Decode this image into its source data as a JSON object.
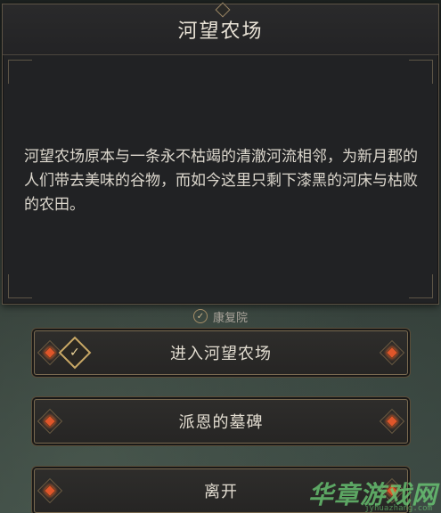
{
  "dialog": {
    "title": "河望农场",
    "description": "河望农场原本与一条永不枯竭的清澈河流相邻，为新月郡的人们带去美味的谷物，而如今这里只剩下漆黑的河床与枯败的农田。"
  },
  "requirement": {
    "icon": "check-circle-icon",
    "text": "康复院"
  },
  "options": [
    {
      "label": "进入河望农场",
      "badge": "check-icon"
    },
    {
      "label": "派恩的墓碑"
    },
    {
      "label": "离开"
    }
  ],
  "watermark": {
    "text": "华章游戏网",
    "sub": "jyhuazhang.com"
  },
  "colors": {
    "accent_gem": "#e0562a",
    "border_gold": "#7a6a50",
    "panel_bg": "#212224",
    "watermark": "#6ed278"
  }
}
